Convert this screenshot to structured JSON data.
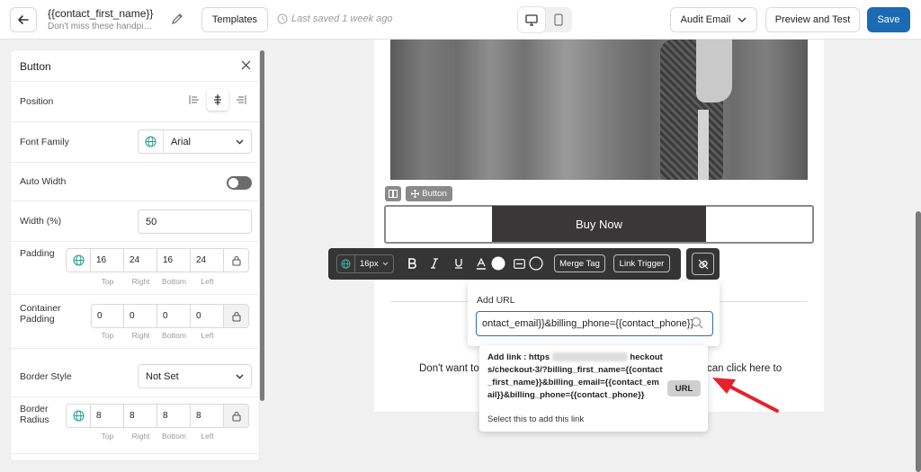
{
  "header": {
    "title": "{{contact_first_name}}",
    "subtitle": "Don't miss these handpicked deals",
    "templates_label": "Templates",
    "saved_text": "Last saved 1 week ago",
    "audit_label": "Audit Email",
    "preview_label": "Preview and Test",
    "save_label": "Save"
  },
  "panel": {
    "title": "Button",
    "position_label": "Position",
    "font_family_label": "Font Family",
    "font_family_value": "Arial",
    "auto_width_label": "Auto Width",
    "auto_width_on": false,
    "width_label": "Width (%)",
    "width_value": "50",
    "padding_label": "Padding",
    "padding": {
      "top": "16",
      "right": "24",
      "bottom": "16",
      "left": "24"
    },
    "container_padding_label": "Container Padding",
    "container_padding": {
      "top": "0",
      "right": "0",
      "bottom": "0",
      "left": "0"
    },
    "border_style_label": "Border Style",
    "border_style_value": "Not Set",
    "border_radius_label": "Border Radius",
    "border_radius": {
      "top": "8",
      "right": "8",
      "bottom": "8",
      "left": "8"
    },
    "side_labels": {
      "top": "Top",
      "right": "Right",
      "bottom": "Bottom",
      "left": "Left"
    }
  },
  "canvas": {
    "element_tag": "Button",
    "button_text": "Buy Now",
    "footer_left": "Don't want to",
    "footer_right": "can click here to"
  },
  "toolbar": {
    "font_size": "16px",
    "merge_tag_label": "Merge Tag",
    "link_trigger_label": "Link Trigger"
  },
  "url_popup": {
    "title": "Add URL",
    "input_value": "ontact_email}}&billing_phone={{contact_phone}}",
    "suggestion_prefix": "Add link : https",
    "suggestion_rest": "heckouts/checkout-3/?billing_first_name={{contact_first_name}}&billing_email={{contact_email}}&billing_phone={{contact_phone}}",
    "suggestion_note": "Select this to add this link",
    "url_button": "URL"
  },
  "colors": {
    "accent": "#1a6bb3",
    "annotation_arrow": "#e8202a",
    "dark_toolbar": "#353535",
    "button_bg": "#393737"
  }
}
